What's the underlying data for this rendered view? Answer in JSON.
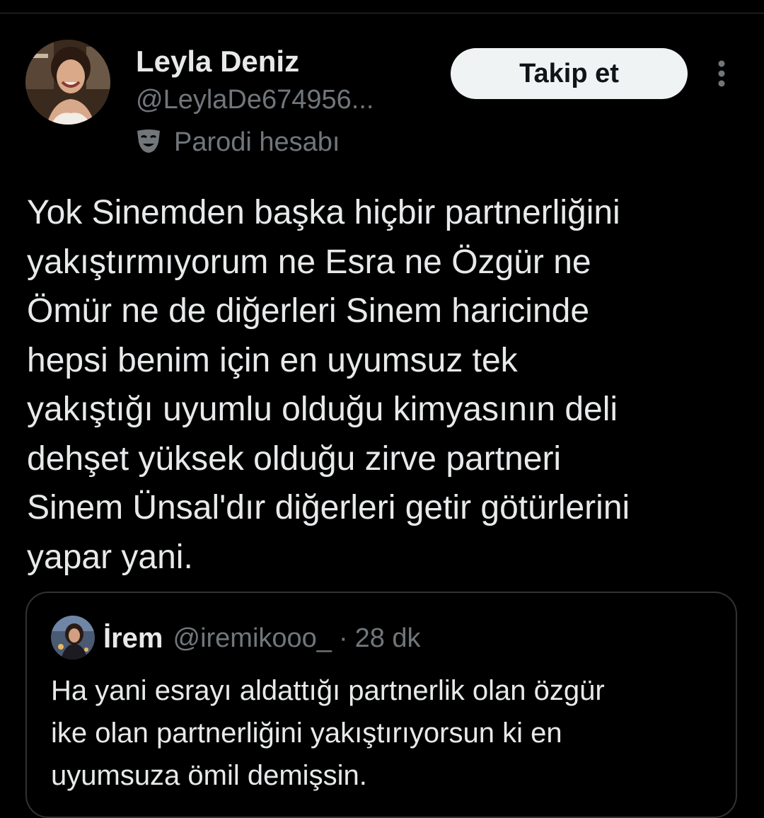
{
  "author": {
    "display_name": "Leyla Deniz",
    "handle": "@LeylaDe674956...",
    "parody_label": "Parodi hesabı",
    "avatar_icon": "profile-photo"
  },
  "actions": {
    "follow_label": "Takip et",
    "more_icon": "more-vertical-icon"
  },
  "tweet": {
    "lines": [
      "Yok Sinemden başka hiçbir partnerliğini",
      "yakıştırmıyorum ne Esra ne Özgür ne",
      "Ömür ne de diğerleri Sinem haricinde",
      "hepsi benim için en uyumsuz tek",
      "yakıştığı uyumlu olduğu kimyasının deli",
      "dehşet yüksek olduğu zirve partneri",
      "Sinem Ünsal'dır diğerleri getir götürlerini",
      "yapar yani."
    ]
  },
  "quote": {
    "display_name": "İrem",
    "handle": "@iremikooo_",
    "separator": "·",
    "time": "28 dk",
    "lines": [
      "Ha yani esrayı aldattığı partnerlik olan özgür",
      "ike olan partnerliğini yakıştırıyorsun ki en",
      "uyumsuza ömil demişsin."
    ]
  },
  "colors": {
    "background": "#000000",
    "primary_text": "#e7e9ea",
    "secondary_text": "#71767b",
    "border": "#2f3336",
    "button_bg": "#eff3f4",
    "button_text": "#0f1419"
  }
}
